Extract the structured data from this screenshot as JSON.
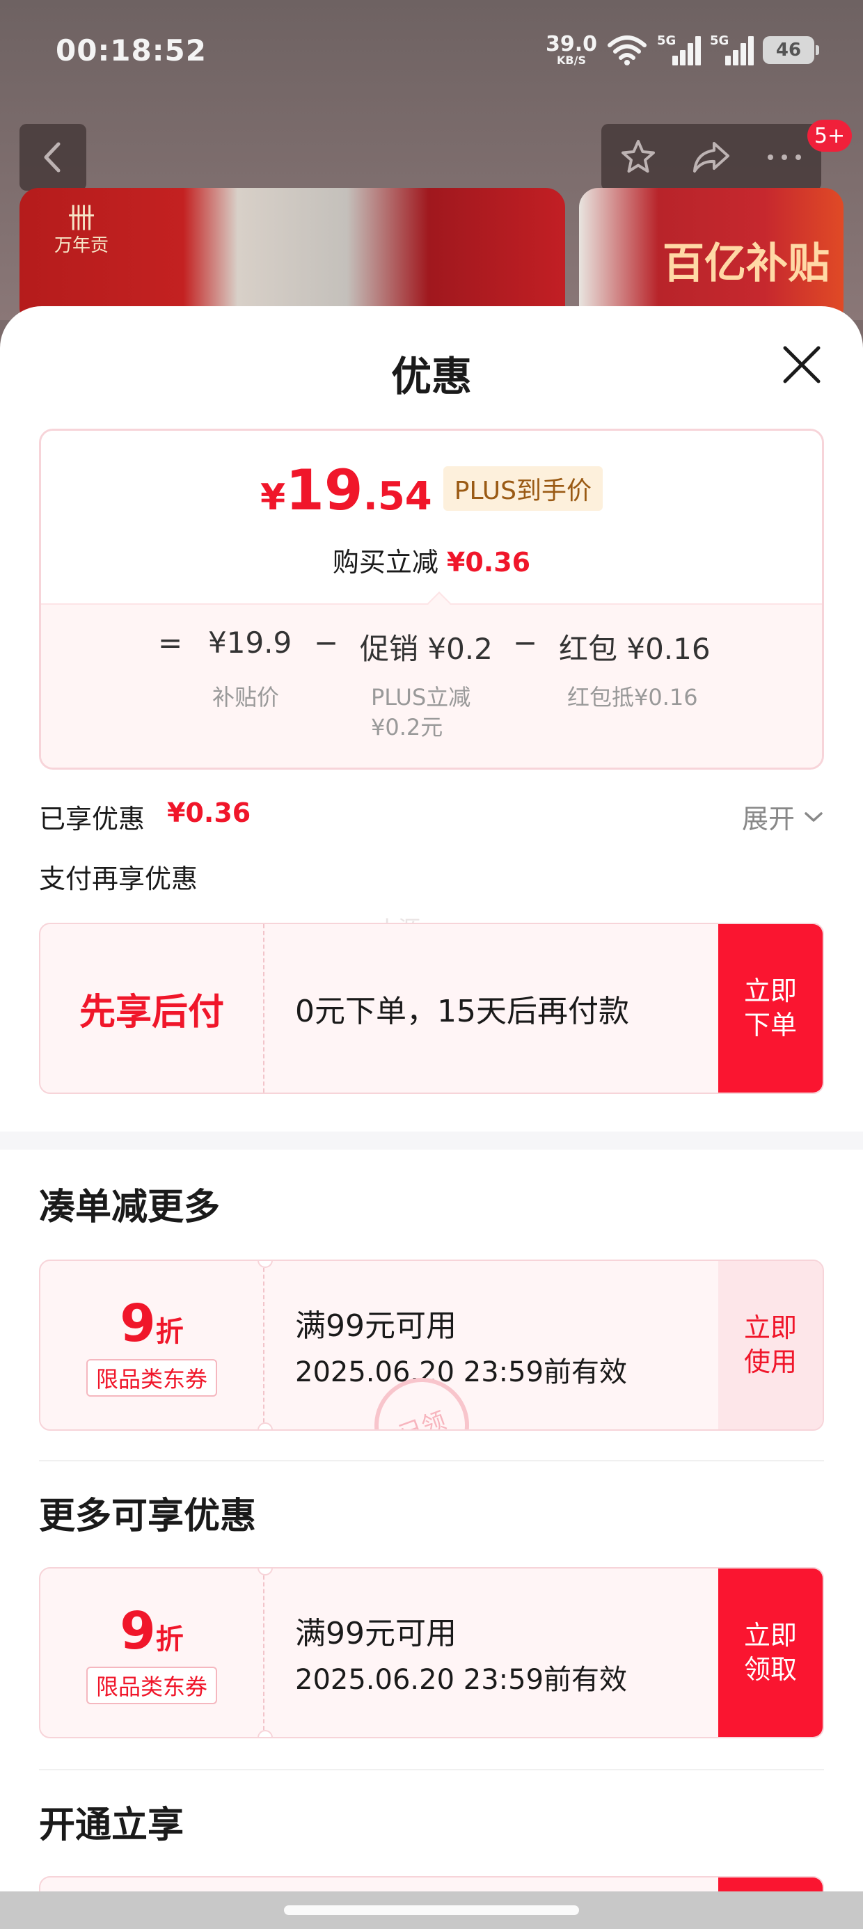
{
  "status_bar": {
    "time": "00:18:52",
    "net_speed_value": "39.0",
    "net_speed_unit": "KB/S",
    "signal1_tag": "5G",
    "signal2_tag": "5G",
    "battery": "46"
  },
  "background": {
    "cart_badge": "5+",
    "brand_logo_text": "万年贡",
    "promo_text": "百亿补贴"
  },
  "sheet": {
    "title": "优惠",
    "price": {
      "symbol": "¥",
      "integer": "19",
      "decimal": ".54",
      "tag": "PLUS到手价",
      "reduce_label": "购买立减",
      "reduce_value": "¥0.36"
    },
    "breakdown": {
      "equals": "=",
      "minus1": "−",
      "minus2": "−",
      "base_value": "¥19.9",
      "base_label": "补贴价",
      "promo_value": "促销 ¥0.2",
      "promo_label_line1": "PLUS立减",
      "promo_label_line2": "¥0.2元",
      "redpacket_value": "红包 ¥0.16",
      "redpacket_label": "红包抵¥0.16"
    },
    "enjoyed": {
      "label": "已享优惠",
      "value": "¥0.36",
      "expand": "展开"
    },
    "pay_more_label": "支付再享优惠",
    "watermark": "小源",
    "bnpl": {
      "title": "先享后付",
      "desc": "0元下单，15天后再付款",
      "action_line1": "立即",
      "action_line2": "下单"
    },
    "section_more_reduce": {
      "title": "凑单减更多",
      "coupon": {
        "discount": "9",
        "unit": "折",
        "scope": "限品类东券",
        "condition": "满99元可用",
        "expiry": "2025.06.20 23:59前有效",
        "action_line1": "立即",
        "action_line2": "使用",
        "stamp": "已领"
      }
    },
    "section_more_offers": {
      "title": "更多可享优惠",
      "coupon": {
        "discount": "9",
        "unit": "折",
        "scope": "限品类东券",
        "condition": "满99元可用",
        "expiry": "2025.06.20 23:59前有效",
        "action_line1": "立即",
        "action_line2": "领取"
      }
    },
    "section_open": {
      "title": "开通立享"
    }
  },
  "colors": {
    "accent_red": "#f0162a",
    "button_red": "#fa1530",
    "coupon_bg": "#fff5f6",
    "plus_tag_bg": "#fdf0dc"
  }
}
